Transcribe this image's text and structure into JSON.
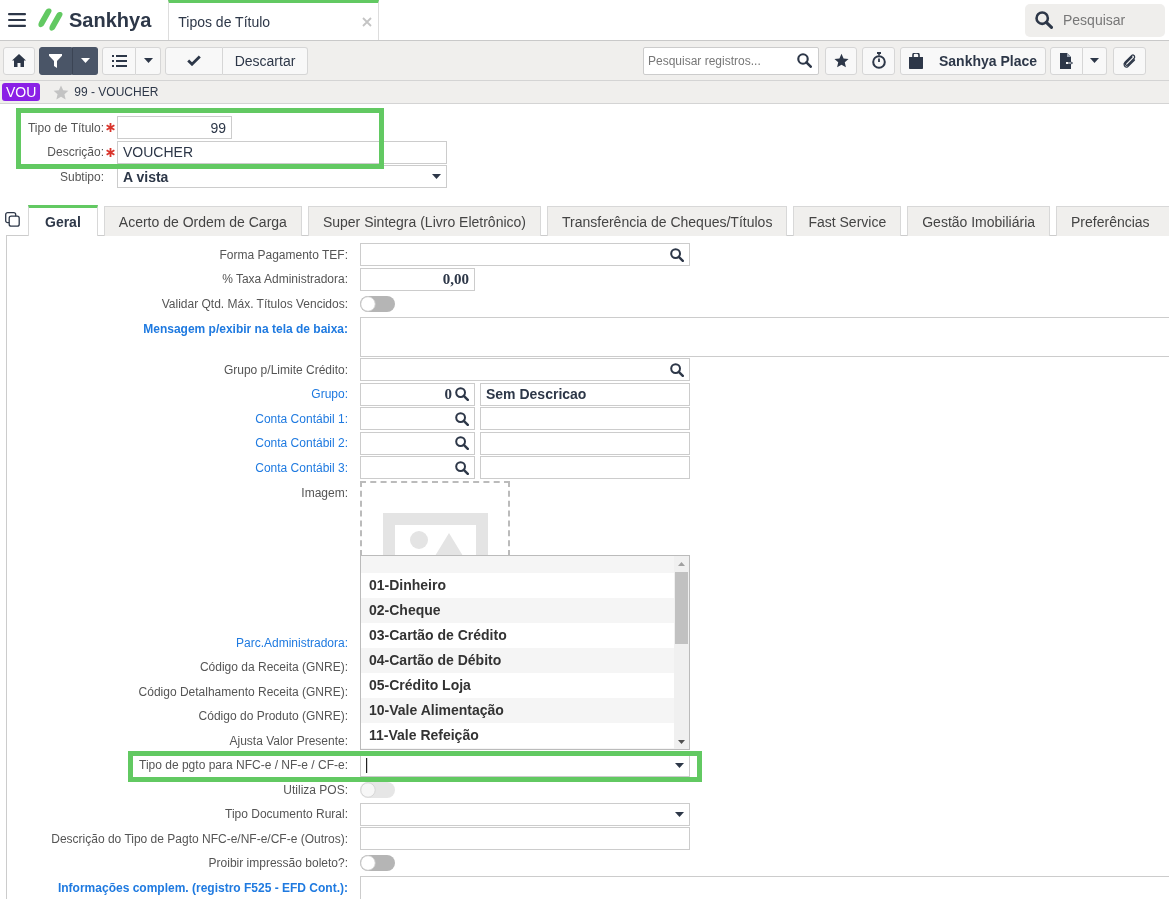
{
  "header": {
    "brand": "Sankhya",
    "tabs": [
      {
        "title": "Tipos de Título",
        "selected": true
      }
    ],
    "search": {
      "placeholder": "Pesquisar"
    }
  },
  "toolbar": {
    "filter": {
      "on": true
    },
    "discard": "Descartar",
    "search": {
      "placeholder": "Pesquisar registros..."
    },
    "place": "Sankhya Place"
  },
  "record": {
    "badge": "VOU",
    "favorite": false,
    "title": "99 - VOUCHER"
  },
  "header_form": {
    "groups": [
      {
        "highlighted": true,
        "fields": [
          {
            "label": "Tipo de Título:",
            "required": true,
            "kind": "number",
            "value": "99"
          },
          {
            "label": "Descrição:",
            "required": true,
            "kind": "text",
            "value": "VOUCHER"
          }
        ]
      },
      {
        "highlighted": false,
        "fields": [
          {
            "label": "Subtipo:",
            "required": false,
            "kind": "select",
            "value": "A vista"
          }
        ]
      }
    ]
  },
  "tabs": [
    {
      "label": "Geral",
      "selected": true
    },
    {
      "label": "Acerto de Ordem de Carga",
      "selected": false
    },
    {
      "label": "Super Sintegra (Livro Eletrônico)",
      "selected": false
    },
    {
      "label": "Transferência de Cheques/Títulos",
      "selected": false
    },
    {
      "label": "Fast Service",
      "selected": false
    },
    {
      "label": "Gestão Imobiliária",
      "selected": false
    },
    {
      "label": "Preferências",
      "selected": false
    }
  ],
  "form": {
    "rows": [
      {
        "label": "Forma Pagamento TEF:",
        "link": false,
        "bold": false,
        "kind": "lookup",
        "highlighted": false
      },
      {
        "label": "% Taxa Administradora:",
        "link": false,
        "bold": false,
        "kind": "number",
        "value": "0,00",
        "highlighted": false
      },
      {
        "label": "Validar Qtd. Máx. Títulos Vencidos:",
        "link": false,
        "bold": false,
        "kind": "toggle",
        "on": false,
        "disabled": false,
        "highlighted": false
      },
      {
        "label": "Mensagem p/exibir na tela de baixa:",
        "link": true,
        "bold": true,
        "kind": "textarea",
        "highlighted": false
      },
      {
        "label": "Grupo p/Limite Crédito:",
        "link": false,
        "bold": false,
        "kind": "lookup",
        "highlighted": false
      },
      {
        "label": "Grupo:",
        "link": true,
        "bold": false,
        "kind": "lookup_pair",
        "value": "0",
        "description": "Sem Descricao",
        "highlighted": false
      },
      {
        "label": "Conta Contábil 1:",
        "link": true,
        "bold": false,
        "kind": "lookup_pair",
        "highlighted": false
      },
      {
        "label": "Conta Contábil 2:",
        "link": true,
        "bold": false,
        "kind": "lookup_pair",
        "highlighted": false
      },
      {
        "label": "Conta Contábil 3:",
        "link": true,
        "bold": false,
        "kind": "lookup_pair",
        "highlighted": false
      },
      {
        "label": "Imagem:",
        "link": false,
        "bold": false,
        "kind": "image",
        "highlighted": false
      },
      {
        "label": "Parc.Administradora:",
        "link": true,
        "bold": false,
        "kind": "label_only",
        "highlighted": false
      },
      {
        "label": "Código da Receita (GNRE):",
        "link": false,
        "bold": false,
        "kind": "label_only",
        "highlighted": false
      },
      {
        "label": "Código Detalhamento Receita (GNRE):",
        "link": false,
        "bold": false,
        "kind": "label_only",
        "highlighted": false
      },
      {
        "label": "Código do Produto (GNRE):",
        "link": false,
        "bold": false,
        "kind": "label_only",
        "highlighted": false
      },
      {
        "label": "Ajusta Valor Presente:",
        "link": false,
        "bold": false,
        "kind": "label_only",
        "highlighted": false
      },
      {
        "label": "Tipo de pgto para NFC-e / NF-e / CF-e:",
        "link": false,
        "bold": false,
        "kind": "select",
        "focused": true,
        "expanded": true,
        "highlighted": true,
        "options": [
          {
            "label": "01-Dinheiro",
            "selected": false
          },
          {
            "label": "02-Cheque",
            "selected": false
          },
          {
            "label": "03-Cartão de Crédito",
            "selected": false
          },
          {
            "label": "04-Cartão de Débito",
            "selected": false
          },
          {
            "label": "05-Crédito Loja",
            "selected": false
          },
          {
            "label": "10-Vale Alimentação",
            "selected": false
          },
          {
            "label": "11-Vale Refeição",
            "selected": false
          }
        ]
      },
      {
        "label": "Utiliza POS:",
        "link": false,
        "bold": false,
        "kind": "toggle",
        "on": false,
        "disabled": true,
        "highlighted": false
      },
      {
        "label": "Tipo Documento Rural:",
        "link": false,
        "bold": false,
        "kind": "select",
        "focused": false,
        "expanded": false,
        "highlighted": false
      },
      {
        "label": "Descrição do Tipo de Pagto NFC-e/NF-e/CF-e (Outros):",
        "link": false,
        "bold": false,
        "kind": "text",
        "highlighted": false
      },
      {
        "label": "Proibir impressão boleto?:",
        "link": false,
        "bold": false,
        "kind": "toggle",
        "on": false,
        "disabled": false,
        "highlighted": false
      },
      {
        "label": "Informações complem. (registro F525 - EFD Cont.):",
        "link": true,
        "bold": true,
        "kind": "textarea",
        "highlighted": false
      }
    ]
  }
}
